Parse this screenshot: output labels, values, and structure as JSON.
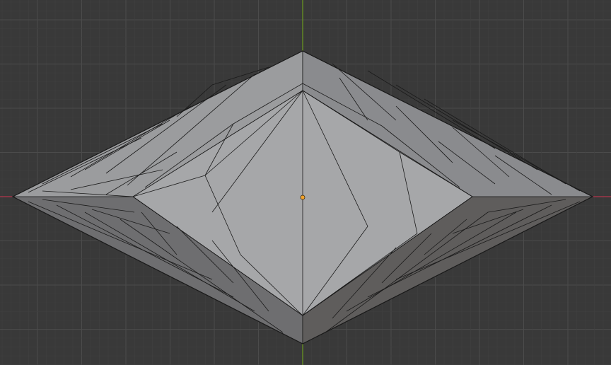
{
  "editor": {
    "type": "3D Viewport",
    "view": "orthographic"
  },
  "colors": {
    "background": "#393939",
    "grid_minor": "#414141",
    "grid_major": "#4b4b4b",
    "axis_x": "#b3354d",
    "axis_y": "#6b9a1f",
    "wire": "#1a1a1a",
    "origin": "#f2a22a",
    "face_top_inner": "#a6a7a9",
    "face_top_bevel_left": "#9b9c9e",
    "face_top_bevel_right": "#8a8b8e",
    "face_bottom_left": "#6e6e70",
    "face_bottom_right": "#5f5d5c"
  },
  "object": {
    "name_icon": "mesh-icon",
    "origin_marker": "origin-dot"
  }
}
